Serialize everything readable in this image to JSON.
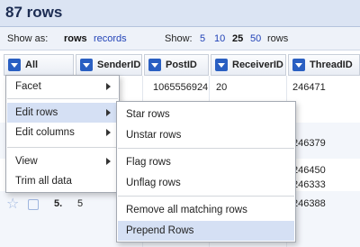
{
  "header": {
    "title": "87 rows"
  },
  "viewbar": {
    "show_as_label": "Show as:",
    "rows": "rows",
    "records": "records",
    "show_label": "Show:",
    "sizes": [
      "5",
      "10",
      "25",
      "50"
    ],
    "selected_size": "25",
    "rows_suffix": "rows"
  },
  "columns": [
    "All",
    "SenderID",
    "PostID",
    "ReceiverID",
    "ThreadID"
  ],
  "rows": [
    {
      "post_id": "1065556924",
      "receiver_id": "20",
      "thread_id": "246471"
    },
    {
      "thread_id": "246379"
    },
    {
      "thread_id": "246450"
    },
    {
      "thread_id": "246333"
    },
    {
      "index": "5.",
      "sender_id": "5",
      "thread_id": "246388"
    }
  ],
  "menu": {
    "items": [
      "Facet",
      "Edit rows",
      "Edit columns",
      "View",
      "Trim all data"
    ],
    "highlighted": "Edit rows"
  },
  "submenu": {
    "items": [
      "Star rows",
      "Unstar rows",
      "Flag rows",
      "Unflag rows",
      "Remove all matching rows",
      "Prepend Rows"
    ],
    "highlighted": "Prepend Rows"
  },
  "colors": {
    "accent": "#2a5fc2",
    "highlight": "#d5e0f4",
    "header_bg": "#dbe4f3"
  }
}
